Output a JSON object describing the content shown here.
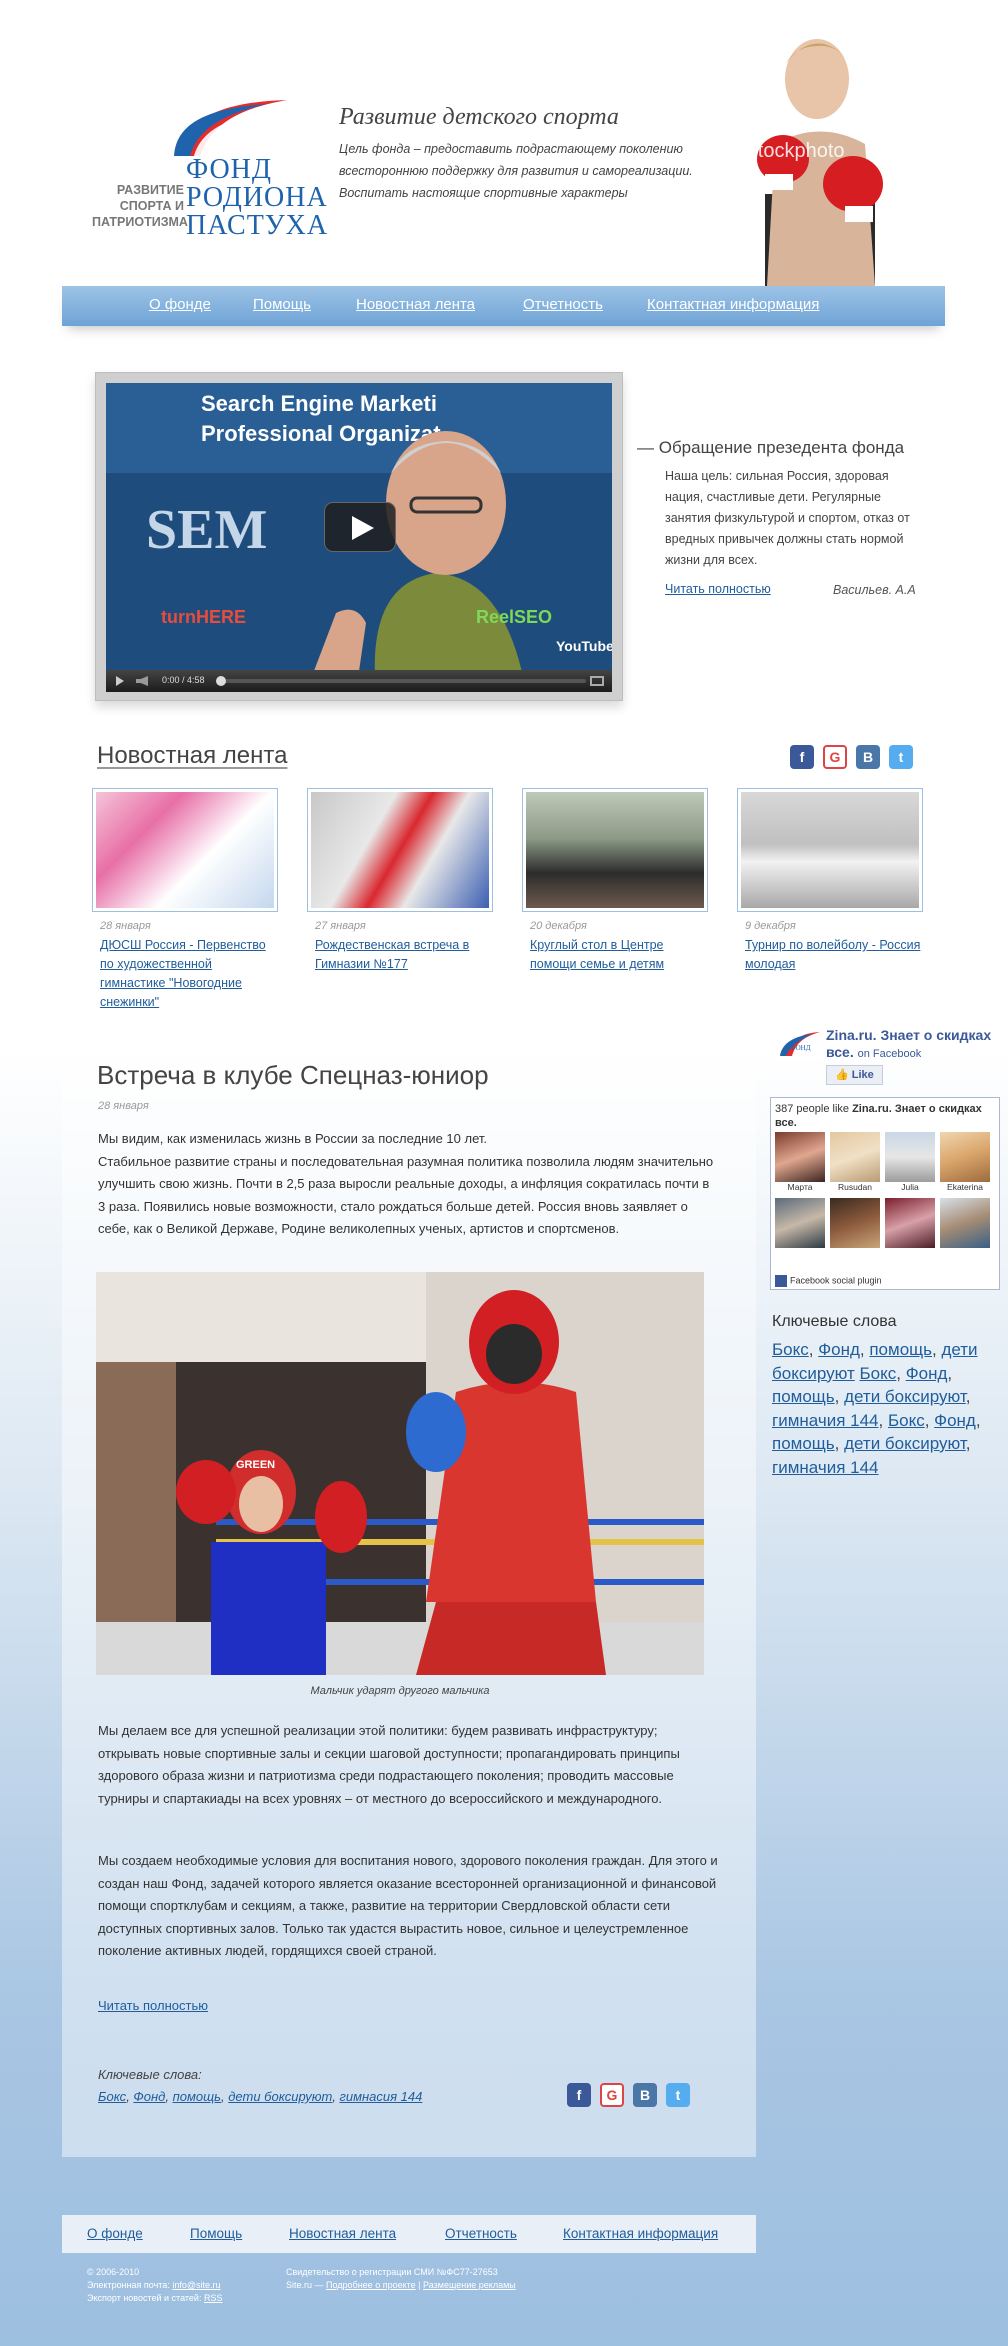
{
  "header": {
    "logo_line1": "ФОНД",
    "logo_line2": "РОДИОНА",
    "logo_line3": "ПАСТУХА",
    "motto_line1": "РАЗВИТИЕ",
    "motto_line2": "СПОРТА И",
    "motto_line3": "ПАТРИОТИЗМА",
    "title": "Развитие детского спорта",
    "description": "Цель фонда – предоставить подрастающему поколению всестороннюю поддержку для развития и самореализации. Воспитать настоящие спортивные характеры",
    "watermark": "iStockphoto"
  },
  "nav": {
    "items": [
      "О фонде",
      "Помощь",
      "Новостная лента",
      "Отчетность",
      "Контактная информация"
    ]
  },
  "video": {
    "time": "0:00 / 4:58",
    "banner_line1": "Search Engine Marketi",
    "banner_line2": "Professional Organizat",
    "banner_sem": "SEM",
    "logo_turnhere": "turnHERE",
    "logo_reelseo": "ReelSEO",
    "logo_youtube": "YouTube",
    "duration_fraction": 0.0
  },
  "appeal": {
    "title": "— Обращение презедента фонда",
    "text": "Наша цель: сильная Россия, здоровая нация, счастливые дети. Регулярные занятия физкультурой и спортом, отказ от вредных привычек должны стать нормой жизни для всех.",
    "read_more": "Читать полностью",
    "author": "Васильев. А.А"
  },
  "news": {
    "title": "Новостная лента",
    "items": [
      {
        "date": "28 января",
        "text": "ДЮСШ Россия - Первенство по художественной гимнастике  \"Новогодние снежинки\""
      },
      {
        "date": "27 января",
        "text": "Рождественская встреча в Гимназии №177"
      },
      {
        "date": "20 декабря",
        "text": "Круглый стол в Центре помощи семье и детям"
      },
      {
        "date": "9 декабря",
        "text": "Турнир по волейболу - Россия молодая"
      }
    ]
  },
  "share_icons": [
    "facebook-icon",
    "google-icon",
    "vkontakte-icon",
    "twitter-icon"
  ],
  "article": {
    "title": "Встреча в клубе Спецназ-юниор",
    "date": "28 января",
    "p1": "Мы видим, как изменилась жизнь в России за последние 10 лет.\nСтабильное развитие страны и последовательная разумная политика позволила людям значительно улучшить свою жизнь. Почти в 2,5 раза выросли реальные доходы, а инфляция сократилась почти в 3 раза.  Появились новые возможности, стало рождаться больше детей. Россия вновь заявляет о себе, как о Великой Державе, Родине великолепных ученых, артистов и спортсменов.",
    "caption": "Мальчик ударят другого мальчика",
    "p2": "Мы делаем все для успешной реализации этой политики: будем развивать инфраструктуру; открывать новые спортивные залы и секции шаговой доступности; пропагандировать принципы здорового образа жизни и патриотизма среди подрастающего поколения; проводить массовые турниры и спартакиады на всех уровнях – от местного до всероссийского и международного.",
    "p3": "Мы создаем необходимые условия для воспитания нового, здорового поколения граждан. Для этого и создан наш Фонд, задачей которого является оказание всесторонней организационной и финансовой помощи спортклубам и секциям, а также, развитие на территории Свердловской области сети доступных спортивных залов. Только так удастся вырастить новое, сильное и целеустремленное поколение активных людей, гордящихся своей страной.",
    "read_more": "Читать полностью",
    "keywords_label": "Ключевые слова:",
    "keywords": [
      "Бокс",
      "Фонд",
      "помощь",
      "дети боксируют",
      "гимнасия 144"
    ],
    "photo_headgear_text": "GREEN"
  },
  "facebook": {
    "page_name": "Zina.ru. Знает о скидках все.",
    "on_facebook": "on Facebook",
    "like_label": "Like",
    "count_prefix": "387 people like ",
    "count_name": "Zina.ru. Знает о скидках все.",
    "faces": [
      "Марта",
      "Rusudan",
      "Julia",
      "Ekaterina",
      "",
      "",
      "",
      ""
    ],
    "plugin_label": "Facebook social plugin"
  },
  "sidebar_keywords": {
    "title": "Ключевые слова",
    "items": [
      "Бокс",
      "Фонд",
      "помощь",
      "дети боксируют",
      "Бокс",
      "Фонд",
      "помощь",
      "дети боксируют",
      "гимначия 144",
      "Бокс",
      "Фонд",
      "помощь",
      "дети боксируют",
      "гимначия 144"
    ]
  },
  "footer": {
    "nav": [
      "О фонде",
      "Помощь",
      "Новостная лента",
      "Отчетность",
      "Контактная информация"
    ],
    "copyright": "© 2006-2010",
    "email_label": "Электронная почта: ",
    "email": "info@site.ru",
    "export_label": "Экспорт новостей и статей: ",
    "rss": "RSS",
    "registration": "Свидетельство о регистрации СМИ №ФС77-27653",
    "site": "Site.ru — ",
    "about_link": "Подробнее о проекте",
    "separator": "|",
    "ads_link": "Размещение рекламы"
  },
  "colors": {
    "accent": "#1f5d9c",
    "nav_top": "#9dc3e6",
    "nav_bottom": "#6ea3d6",
    "logo_blue": "#1f63ad",
    "logo_red": "#e32c2c"
  }
}
